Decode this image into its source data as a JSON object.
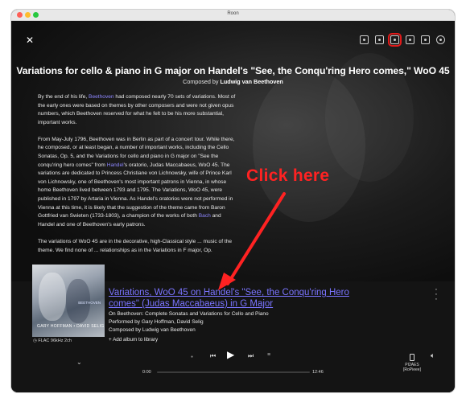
{
  "window": {
    "title": "Roon"
  },
  "header": {
    "title": "Variations for cello & piano in G major on Handel's \"See, the Conqu'ring Hero comes,\" WoO 45",
    "composed_prefix": "Composed by",
    "composer": "Ludwig van Beethoven"
  },
  "icons": {
    "close": "close-icon",
    "top": [
      "user-icon",
      "album-icon",
      "headphones-icon",
      "library-icon",
      "bookmark-icon",
      "settings-icon"
    ],
    "highlighted": "headphones-icon"
  },
  "bio": {
    "p1": {
      "pre": "By the end of his life, ",
      "link": "Beethoven",
      "post": " had composed nearly 70 sets of variations. Most of the early ones were based on themes by other composers and were not given opus numbers, which Beethoven reserved for what he felt to be his more substantial, important works."
    },
    "p2": {
      "pre": "From May-July 1796, Beethoven was in Berlin as part of a concert tour. While there, he composed, or at least began, a number of important works, including the Cello Sonatas, Op. 5, and the Variations for cello and piano in G major on \"See the conqu'ring hero comes\" from ",
      "link1": "Handel",
      "mid": "'s oratorio, Judas Maccabaeus, WoO 45. The variations are dedicated to Princess Christiane von Lichnowsky, wife of Prince Karl von Lichnowsky, one of Beethoven's most important patrons in Vienna, in whose home Beethoven lived between 1793 and 1795. The Variations, WoO 45, were published in 1797 by Artaria in Vienna. As Handel's oratorios were not performed in Vienna at this time, it is likely that the suggestion of the theme came from Baron Gottfried van Swieten (1733-1803), a champion of the works of both ",
      "link2": "Bach",
      "post": " and Handel and one of Beethoven's early patrons."
    },
    "p3": "The variations of WoO 45 are in the decorative, high-Classical style ... music of the theme. We find none of ... relationships as in the Variations in F major, Op."
  },
  "annotation": {
    "text": "Click here",
    "color": "#ff2222"
  },
  "now_playing": {
    "track_title": "Variations, WoO 45 on Handel's \"See, the Conqu'ring Hero comes\" (Judas Maccabaeus) in G Major",
    "album_line": "On Beethoven: Complete Sonatas and Variations for Cello and Piano",
    "performers_line": "Performed by Gary Hoffman, David Selig",
    "composer_line": "Composed by Ludwig van Beethoven",
    "add_to_library": "Add album to library",
    "format": "FLAC 96kHz 2ch",
    "album_art_text_left": "GARY HOFFMAN • DAVID SELIG",
    "album_art_text_right": "BEETHOVEN",
    "time_elapsed": "0:00",
    "time_total": "12:46",
    "progress": 0.0,
    "zone_name": "PI2AES",
    "zone_sub": "[RoPieee]"
  },
  "colors": {
    "link": "#8d86ff",
    "track_title": "#7a74ff",
    "highlight_box": "#e11a1a"
  }
}
